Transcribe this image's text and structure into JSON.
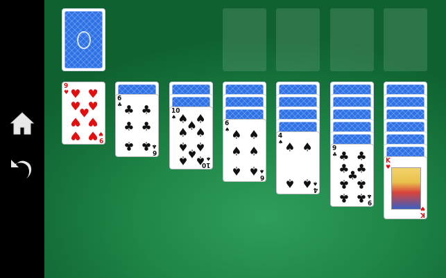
{
  "sidebar": {
    "home_icon": "home-icon",
    "undo_icon": "undo-icon"
  },
  "colors": {
    "felt": "#1f8748",
    "card_back": "#2f72e6",
    "red_suit": "#e01010",
    "black_suit": "#111111"
  },
  "stock": {
    "face_down": true
  },
  "foundations": [
    {
      "empty": true
    },
    {
      "empty": true
    },
    {
      "empty": true
    },
    {
      "empty": true
    }
  ],
  "tableau": [
    {
      "face_down": 0,
      "top": {
        "rank": "9",
        "suit": "♥",
        "color": "red"
      }
    },
    {
      "face_down": 1,
      "top": {
        "rank": "6",
        "suit": "♣",
        "color": "black"
      }
    },
    {
      "face_down": 2,
      "top": {
        "rank": "10",
        "suit": "♠",
        "color": "black"
      }
    },
    {
      "face_down": 3,
      "top": {
        "rank": "6",
        "suit": "♠",
        "color": "black"
      }
    },
    {
      "face_down": 4,
      "top": {
        "rank": "4",
        "suit": "♠",
        "color": "black"
      }
    },
    {
      "face_down": 5,
      "top": {
        "rank": "9",
        "suit": "♣",
        "color": "black"
      }
    },
    {
      "face_down": 6,
      "top": {
        "rank": "K",
        "suit": "♥",
        "color": "red"
      }
    }
  ]
}
